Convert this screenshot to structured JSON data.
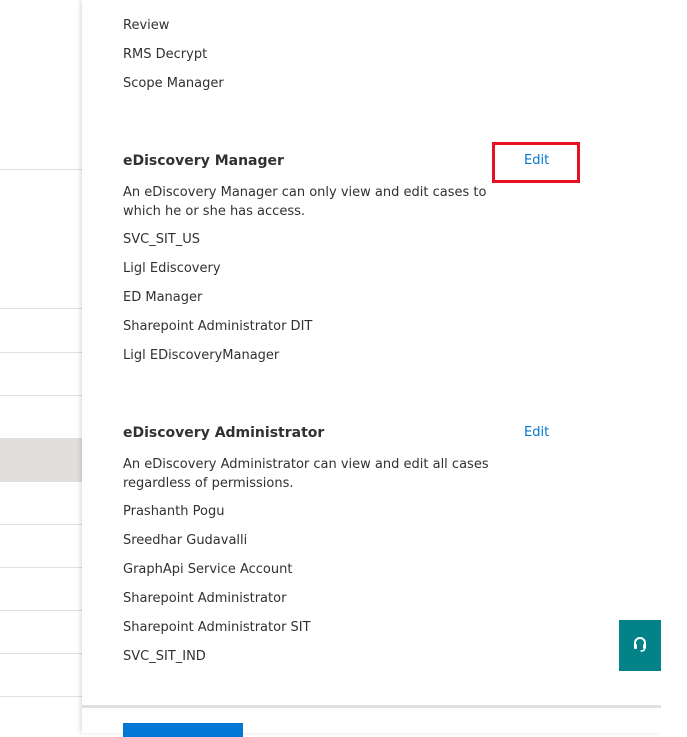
{
  "top_members": [
    "Review",
    "RMS Decrypt",
    "Scope Manager"
  ],
  "sections": [
    {
      "title": "eDiscovery Manager",
      "edit_label": "Edit",
      "description": "An eDiscovery Manager can only view and edit cases to which he or she has access.",
      "members": [
        "SVC_SIT_US",
        "Ligl Ediscovery",
        "ED Manager",
        "Sharepoint Administrator DIT",
        "Ligl EDiscoveryManager"
      ]
    },
    {
      "title": "eDiscovery Administrator",
      "edit_label": "Edit",
      "description": "An eDiscovery Administrator can view and edit all cases regardless of permissions.",
      "members": [
        "Prashanth Pogu",
        "Sreedhar Gudavalli",
        "GraphApi Service Account",
        "Sharepoint Administrator",
        "Sharepoint Administrator SIT",
        "SVC_SIT_IND"
      ]
    }
  ],
  "colors": {
    "link": "#0078d4",
    "highlight": "#e81123",
    "help_button": "#038387",
    "primary_button": "#0078d4"
  },
  "icons": {
    "help": "headset-icon"
  }
}
